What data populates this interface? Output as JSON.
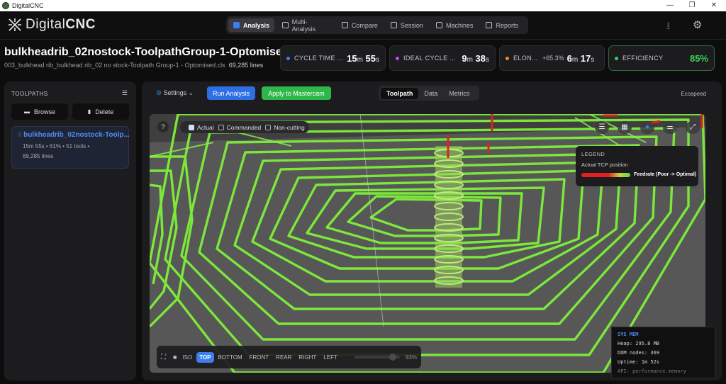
{
  "window": {
    "title": "DigitalCNC",
    "minimize": "—",
    "maximize": "❐",
    "close": "✕"
  },
  "header": {
    "logo_thin": "Digital",
    "logo_bold": "CNC",
    "nav": [
      {
        "label": "Analysis",
        "active": true
      },
      {
        "label": "Multi-Analysis"
      },
      {
        "label": "Compare"
      },
      {
        "label": "Session"
      },
      {
        "label": "Machines"
      },
      {
        "label": "Reports"
      }
    ],
    "download_icon": "⭳",
    "settings_icon": "⚙"
  },
  "file": {
    "title": "bulkheadrib_02nostock-ToolpathGroup-1-Optomised",
    "path": "003_bulkhead rib_bulkhead rib_02 no stock-Toolpath Group-1 - Optomised.cls",
    "lines": "69,285 lines"
  },
  "stats": {
    "cycle_time": {
      "label": "CYCLE TIME ...",
      "min": "15",
      "sec": "55",
      "dot": "#3d7ef0"
    },
    "ideal_cycle": {
      "label": "IDEAL CYCLE ...",
      "min": "9",
      "sec": "38",
      "dot": "#c04ee0"
    },
    "elongation": {
      "label": "ELON...",
      "pct": "+65.3%",
      "min": "6",
      "sec": "17",
      "dot": "#f08a2a"
    },
    "efficiency": {
      "label": "EFFICIENCY",
      "value": "85%",
      "dot": "#39d353"
    },
    "unit_m": "m",
    "unit_s": "s"
  },
  "sidebar": {
    "heading": "TOOLPATHS",
    "browse": "Browse",
    "delete": "Delete",
    "item": {
      "title": "bulkheadrib_02nostock-Toolp...",
      "meta1": "15m 55s  •  61%  •  51 tools  •",
      "meta2": "69,285 lines"
    }
  },
  "toolbar": {
    "settings": "Settings",
    "run": "Run Analysis",
    "apply": "Apply to Mastercam",
    "tabs": [
      "Toolpath",
      "Data",
      "Metrics"
    ],
    "active_tab": "Toolpath",
    "ecospeed": "Ecospeed"
  },
  "viewport": {
    "help": "?",
    "filters": [
      {
        "label": "Actual",
        "checked": true
      },
      {
        "label": "Commanded",
        "checked": false
      },
      {
        "label": "Non-cutting",
        "checked": false
      }
    ],
    "legend": {
      "heading": "LEGEND",
      "subtitle": "Actual TCP position",
      "bar_label": "Feedrate (Poor -> Optimal)"
    },
    "views": [
      "ISO",
      "TOP",
      "BOTTOM",
      "FRONT",
      "REAR",
      "RIGHT",
      "LEFT"
    ],
    "active_view": "TOP",
    "zoom": "93%"
  },
  "sysmem": {
    "title": "SYS MEM",
    "heap": "Heap: 295.8 MB",
    "dom": "DOM nodes: 369",
    "uptime": "Uptime: 1m 52s",
    "api": "API: performance.memory"
  }
}
